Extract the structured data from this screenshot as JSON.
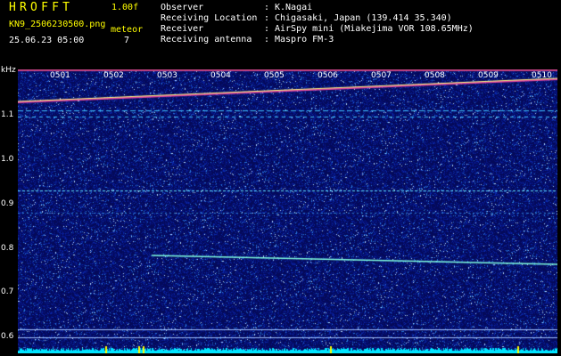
{
  "header": {
    "app_title": "HROFFT",
    "version": "1.00f",
    "filename": "KN9_2506230500.png",
    "datetime": "25.06.23 05:00",
    "meteor_label": "meteor",
    "meteor_count": "7"
  },
  "info": [
    {
      "key": "Observer",
      "sep": ":",
      "value": "K.Nagai"
    },
    {
      "key": "Receiving Location",
      "sep": ":",
      "value": "Chigasaki, Japan (139.414 35.340)"
    },
    {
      "key": "Receiver",
      "sep": ":",
      "value": "AirSpy mini (Miakejima VOR 108.65MHz)"
    },
    {
      "key": "Receiving antenna",
      "sep": ":",
      "value": "Maspro FM-3"
    }
  ],
  "axis": {
    "unit": "kHz",
    "y_ticks": [
      "1.1",
      "1.0",
      "0.9",
      "0.8",
      "0.7",
      "0.6"
    ],
    "time_ticks": [
      "0501",
      "0502",
      "0503",
      "0504",
      "0505",
      "0506",
      "0507",
      "0508",
      "0509",
      "0510"
    ]
  },
  "colors": {
    "background": "#000000",
    "plot_bg": "#060a5e",
    "title": "#ffff00",
    "text": "#ffffff",
    "trace": "#00e5ff"
  }
}
